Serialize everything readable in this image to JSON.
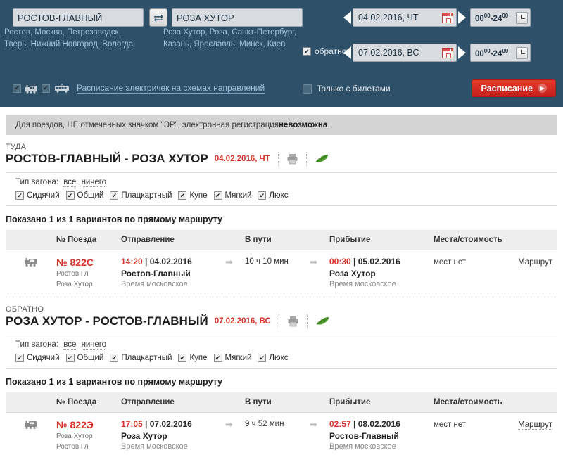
{
  "search_form": {
    "from_value": "РОСТОВ-ГЛАВНЫЙ",
    "to_value": "РОЗА ХУТОР",
    "from_suggestions": "Ростов, Москва, Петрозаводск, Тверь, Нижний Новгород, Вологда",
    "to_suggestions": "Роза Хутор, Роза, Санкт-Петербург, Казань, Ярославль, Минск, Киев",
    "swap_icon": "swap-arrows-icon",
    "train_icon": "steam-train-icon",
    "electric_train_icon": "electric-train-icon",
    "transport_link": "Расписание электричек на схемах направлений",
    "date_there": "04.02.2016, ЧТ",
    "date_back": "07.02.2016, ВС",
    "time_range_hours": "00",
    "time_range_minutes": "00",
    "time_range_hours_end": "24",
    "time_range_minutes_end": "00",
    "time_separator": "-",
    "back_label": "обратно",
    "back_checked": true,
    "tickets_only_label": "Только с билетами",
    "tickets_only_checked": false,
    "submit_label": "Расписание",
    "calendar_icon": "calendar-icon",
    "clock_icon": "clock-icon"
  },
  "notice": {
    "text_before": "Для поездов, НЕ отмеченных значком \"ЭР\", электронная регистрация ",
    "text_bold": "невозможна",
    "text_after": "."
  },
  "sections": [
    {
      "direction_label": "ТУДА",
      "route_title": "РОСТОВ-ГЛАВНЫЙ - РОЗА ХУТОР",
      "route_date": "04.02.2016, ЧТ",
      "print_icon": "printer-icon",
      "eco_icon": "green-leaf-icon",
      "filter_label": "Тип вагона:",
      "filter_all": "все",
      "filter_none": "ничего",
      "wagon_types": [
        {
          "label": "Сидячий",
          "checked": true
        },
        {
          "label": "Общий",
          "checked": true
        },
        {
          "label": "Плацкартный",
          "checked": true
        },
        {
          "label": "Купе",
          "checked": true
        },
        {
          "label": "Мягкий",
          "checked": true
        },
        {
          "label": "Люкс",
          "checked": true
        }
      ],
      "results_count": "Показано 1 из 1 вариантов по прямому маршруту",
      "columns": [
        "",
        "№ Поезда",
        "Отправление",
        "",
        "В пути",
        "",
        "Прибытие",
        "Места/стоимость",
        ""
      ],
      "rows": [
        {
          "train_icon": "train-icon",
          "number": "№ 822С",
          "from_short": "Ростов Гл",
          "to_short": "Роза Хутор",
          "dep_time": "14:20",
          "dep_sep": " | ",
          "dep_date": "04.02.2016",
          "dep_station": "Ростов-Главный",
          "dep_tz": "Время московское",
          "duration": "10 ч 10 мин",
          "arr_time": "00:30",
          "arr_sep": " | ",
          "arr_date": "05.02.2016",
          "arr_station": "Роза Хутор",
          "arr_tz": "Время московское",
          "seats": "мест нет",
          "route_link": "Маршрут"
        }
      ]
    },
    {
      "direction_label": "ОБРАТНО",
      "route_title": "РОЗА ХУТОР - РОСТОВ-ГЛАВНЫЙ",
      "route_date": "07.02.2016, ВС",
      "print_icon": "printer-icon",
      "eco_icon": "green-leaf-icon",
      "filter_label": "Тип вагона:",
      "filter_all": "все",
      "filter_none": "ничего",
      "wagon_types": [
        {
          "label": "Сидячий",
          "checked": true
        },
        {
          "label": "Общий",
          "checked": true
        },
        {
          "label": "Плацкартный",
          "checked": true
        },
        {
          "label": "Купе",
          "checked": true
        },
        {
          "label": "Мягкий",
          "checked": true
        },
        {
          "label": "Люкс",
          "checked": true
        }
      ],
      "results_count": "Показано 1 из 1 вариантов по прямому маршруту",
      "columns": [
        "",
        "№ Поезда",
        "Отправление",
        "",
        "В пути",
        "",
        "Прибытие",
        "Места/стоимость",
        ""
      ],
      "rows": [
        {
          "train_icon": "train-icon",
          "number": "№ 822Э",
          "from_short": "Роза Хутор",
          "to_short": "Ростов Гл",
          "dep_time": "17:05",
          "dep_sep": " | ",
          "dep_date": "07.02.2016",
          "dep_station": "Роза Хутор",
          "dep_tz": "Время московское",
          "duration": "9 ч 52 мин",
          "arr_time": "02:57",
          "arr_sep": " | ",
          "arr_date": "08.02.2016",
          "arr_station": "Ростов-Главный",
          "arr_tz": "Время московское",
          "seats": "мест нет",
          "route_link": "Маршрут"
        }
      ]
    }
  ],
  "colors": {
    "header_bg": "#2e5068",
    "accent_red": "#d9322a",
    "link_blue": "#9fc6e0",
    "notice_bg": "#d4d4d4"
  }
}
